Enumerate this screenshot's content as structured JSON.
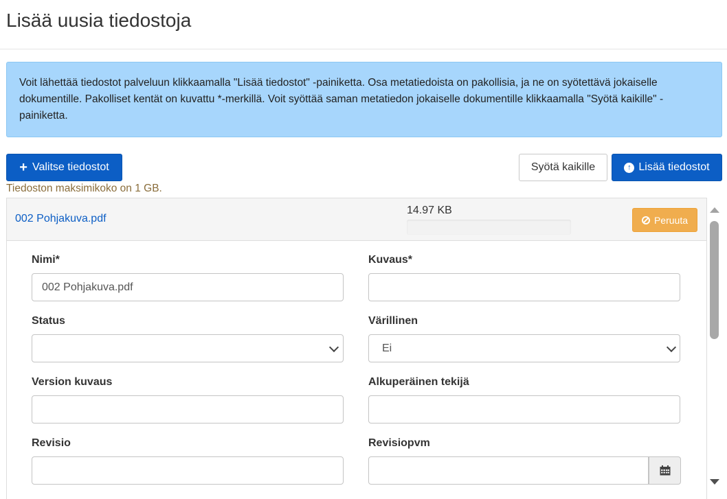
{
  "page": {
    "title": "Lisää uusia tiedostoja",
    "info": "Voit lähettää tiedostot palveluun klikkaamalla \"Lisää tiedostot\" -painiketta. Osa metatiedoista on pakollisia, ja ne on syötettävä jokaiselle dokumentille. Pakolliset kentät on kuvattu *-merkillä. Voit syöttää saman metatiedon jokaiselle dokumentille klikkaamalla \"Syötä kaikille\" -painiketta."
  },
  "toolbar": {
    "select_files_label": "Valitse tiedostot",
    "fill_all_label": "Syötä kaikille",
    "add_files_label": "Lisää tiedostot",
    "max_size_note": "Tiedoston maksimikoko on 1 GB."
  },
  "file": {
    "name": "002 Pohjakuva.pdf",
    "size": "14.97 KB",
    "cancel_label": "Peruuta"
  },
  "form": {
    "name": {
      "label": "Nimi*",
      "value": "002 Pohjakuva.pdf"
    },
    "description": {
      "label": "Kuvaus*",
      "value": ""
    },
    "status": {
      "label": "Status",
      "value": ""
    },
    "colored": {
      "label": "Värillinen",
      "value": "Ei"
    },
    "version_description": {
      "label": "Version kuvaus",
      "value": ""
    },
    "original_author": {
      "label": "Alkuperäinen tekijä",
      "value": ""
    },
    "revision": {
      "label": "Revisio",
      "value": ""
    },
    "revision_date": {
      "label": "Revisiopvm",
      "value": ""
    }
  },
  "colors": {
    "primary": "#0c5ec5",
    "info_bg": "#a7d6fc",
    "warning": "#f0ad4e",
    "note": "#8a6d3b"
  }
}
